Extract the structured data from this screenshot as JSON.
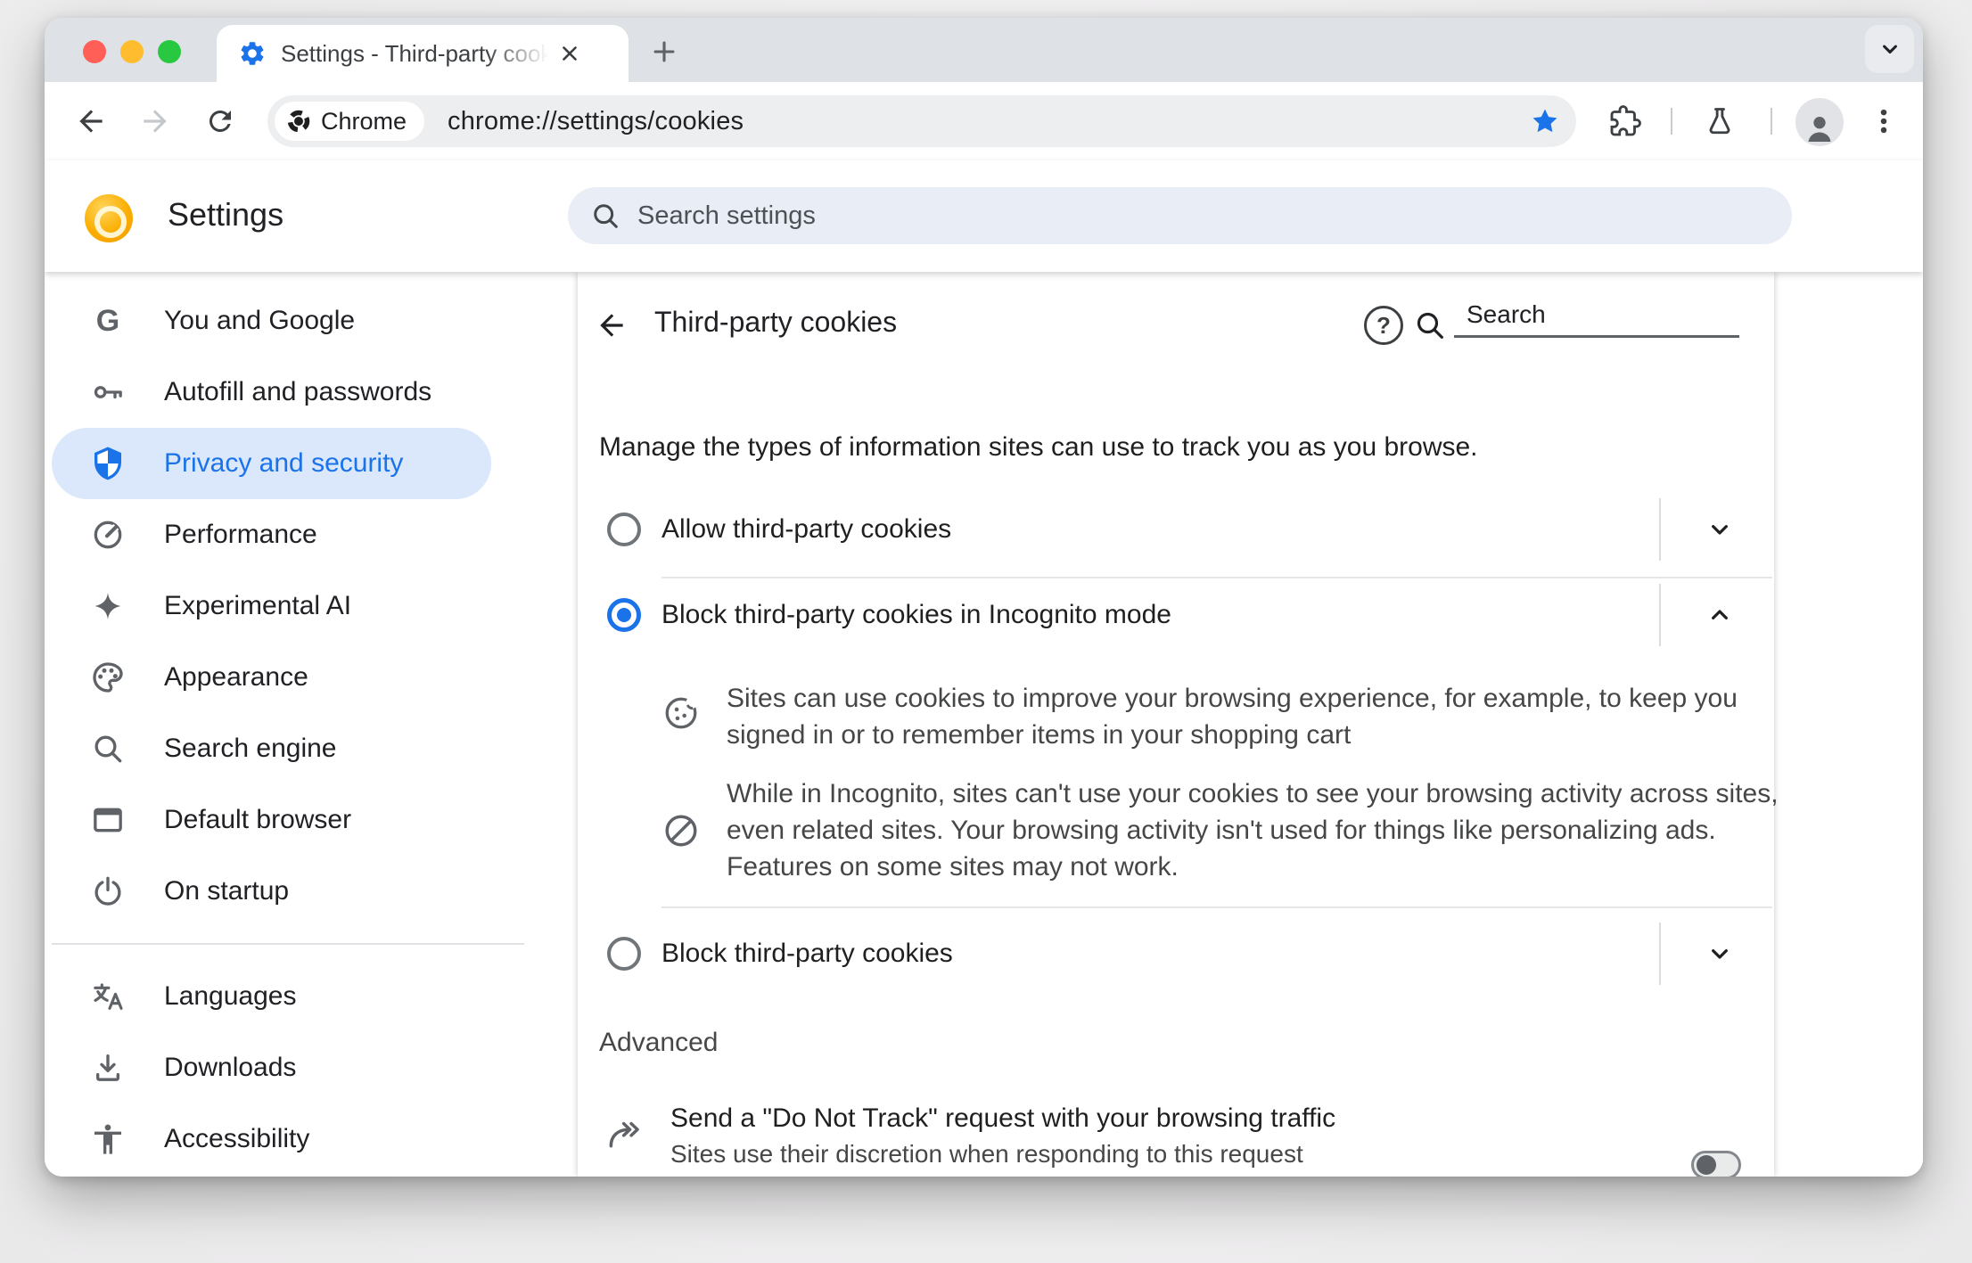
{
  "window": {
    "tab_title": "Settings - Third-party cookies",
    "tab_favicon": "settings-gear-icon"
  },
  "toolbar": {
    "chip_label": "Chrome",
    "url": "chrome://settings/cookies"
  },
  "settings_header": {
    "title": "Settings",
    "search_placeholder": "Search settings"
  },
  "sidebar": {
    "items": [
      {
        "label": "You and Google",
        "icon": "google-g-icon",
        "selected": false
      },
      {
        "label": "Autofill and passwords",
        "icon": "key-icon",
        "selected": false
      },
      {
        "label": "Privacy and security",
        "icon": "shield-icon",
        "selected": true
      },
      {
        "label": "Performance",
        "icon": "speedometer-icon",
        "selected": false
      },
      {
        "label": "Experimental AI",
        "icon": "sparkle-icon",
        "selected": false
      },
      {
        "label": "Appearance",
        "icon": "palette-icon",
        "selected": false
      },
      {
        "label": "Search engine",
        "icon": "magnifier-icon",
        "selected": false
      },
      {
        "label": "Default browser",
        "icon": "browser-window-icon",
        "selected": false
      },
      {
        "label": "On startup",
        "icon": "power-icon",
        "selected": false
      }
    ],
    "footer_items": [
      {
        "label": "Languages",
        "icon": "translate-icon"
      },
      {
        "label": "Downloads",
        "icon": "download-icon"
      },
      {
        "label": "Accessibility",
        "icon": "accessibility-icon"
      }
    ]
  },
  "content": {
    "title": "Third-party cookies",
    "search_placeholder": "Search",
    "intro": "Manage the types of information sites can use to track you as you browse.",
    "radios": [
      {
        "label": "Allow third-party cookies",
        "selected": false,
        "expanded": false
      },
      {
        "label": "Block third-party cookies in Incognito mode",
        "selected": true,
        "expanded": true
      },
      {
        "label": "Block third-party cookies",
        "selected": false,
        "expanded": false
      }
    ],
    "descriptions": [
      "Sites can use cookies to improve your browsing experience, for example, to keep you signed in or to remember items in your shopping cart",
      "While in Incognito, sites can't use your cookies to see your browsing activity across sites, even related sites. Your browsing activity isn't used for things like personalizing ads. Features on some sites may not work."
    ],
    "advanced_label": "Advanced",
    "dnt": {
      "title": "Send a \"Do Not Track\" request with your browsing traffic",
      "subtitle": "Sites use their discretion when responding to this request",
      "enabled": false
    }
  },
  "colors": {
    "accent_blue": "#1a73e8",
    "selected_nav_bg": "#dbe7fb",
    "tabstrip_bg": "#dee1e6",
    "traffic_red": "#ff5f57",
    "traffic_yellow": "#febc2e",
    "traffic_green": "#28c840"
  }
}
